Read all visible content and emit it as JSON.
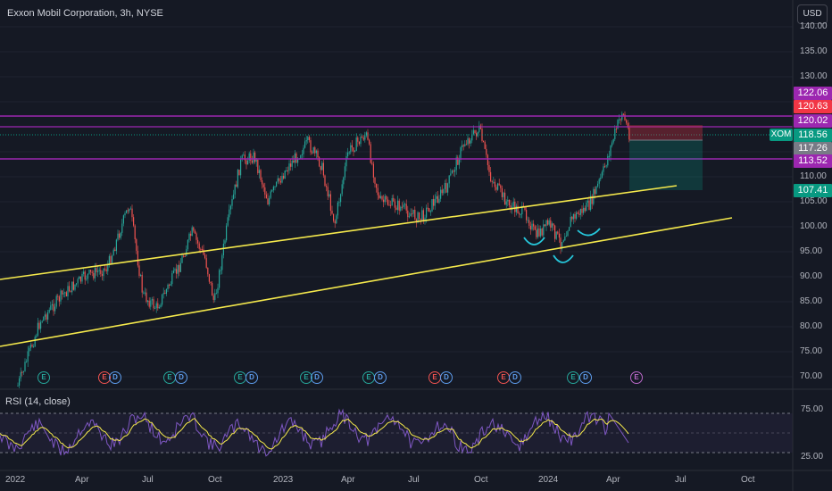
{
  "header": {
    "title": "Exxon Mobil Corporation, 3h, NYSE",
    "currency_button": "USD"
  },
  "rsi": {
    "title": "RSI (14, close)",
    "levels": [
      "75.00",
      "25.00"
    ]
  },
  "price_axis": [
    "140.00",
    "135.00",
    "130.00",
    "125.00",
    "110.00",
    "105.00",
    "100.00",
    "95.00",
    "90.00",
    "85.00",
    "80.00",
    "75.00",
    "70.00"
  ],
  "price_tags": [
    {
      "label": "122.06",
      "color": "#9c27b0"
    },
    {
      "label": "120.63",
      "color": "#f23645"
    },
    {
      "label": "120.02",
      "color": "#9c27b0"
    },
    {
      "label": "118.56",
      "color": "#089981"
    },
    {
      "label": "117.26",
      "color": "#787b86"
    },
    {
      "label": "113.52",
      "color": "#9c27b0"
    },
    {
      "label": "107.41",
      "color": "#089981"
    }
  ],
  "ticker_badge": "XOM",
  "time_axis": [
    "2022",
    "Apr",
    "Jul",
    "Oct",
    "2023",
    "Apr",
    "Jul",
    "Oct",
    "2024",
    "Apr",
    "Jul",
    "Oct"
  ],
  "event_badges": [
    {
      "label": "E",
      "kind": "earnings-teal"
    },
    {
      "label": "E",
      "kind": "earnings-red"
    },
    {
      "label": "D",
      "kind": "dividend"
    },
    {
      "label": "E",
      "kind": "earnings-teal"
    },
    {
      "label": "D",
      "kind": "dividend"
    },
    {
      "label": "E",
      "kind": "earnings-teal"
    },
    {
      "label": "D",
      "kind": "dividend"
    },
    {
      "label": "E",
      "kind": "earnings-teal"
    },
    {
      "label": "D",
      "kind": "dividend"
    },
    {
      "label": "E",
      "kind": "earnings-teal"
    },
    {
      "label": "D",
      "kind": "dividend"
    },
    {
      "label": "E",
      "kind": "earnings-red"
    },
    {
      "label": "D",
      "kind": "dividend"
    },
    {
      "label": "E",
      "kind": "earnings-red"
    },
    {
      "label": "D",
      "kind": "dividend"
    },
    {
      "label": "E",
      "kind": "earnings-teal"
    },
    {
      "label": "D",
      "kind": "dividend"
    },
    {
      "label": "E",
      "kind": "earnings-purple"
    }
  ],
  "colors": {
    "bg": "#151924",
    "up": "#26a69a",
    "down": "#ef5350",
    "trendline": "#f5e94c",
    "hline": "#9c27b0",
    "rsi": "#7e57c2",
    "rsi_ma": "#f5e94c"
  }
}
